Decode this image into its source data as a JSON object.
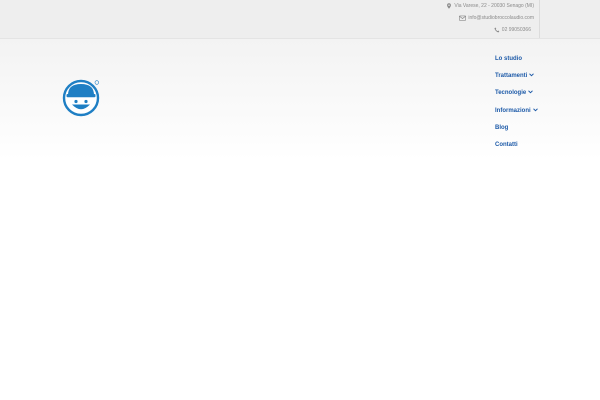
{
  "topbar": {
    "address": "Via Varese, 22 - 20030 Senago (MI)",
    "email": "info@studiobroccolaudio.com",
    "phone": "02 99050366"
  },
  "nav": {
    "items": [
      {
        "label": "Lo studio",
        "has_dropdown": false
      },
      {
        "label": "Trattamenti",
        "has_dropdown": true
      },
      {
        "label": "Tecnologie",
        "has_dropdown": true
      },
      {
        "label": "Informazioni",
        "has_dropdown": true
      },
      {
        "label": "Blog",
        "has_dropdown": false
      },
      {
        "label": "Contatti",
        "has_dropdown": false
      }
    ]
  },
  "logo": {
    "icon": "smiling-face-logo",
    "registered_mark": "®"
  },
  "colors": {
    "accent": "#1d5aa8",
    "logo": "#1f7fc4",
    "muted_text": "#8a8a8a",
    "topbar": "#eeeeee"
  }
}
